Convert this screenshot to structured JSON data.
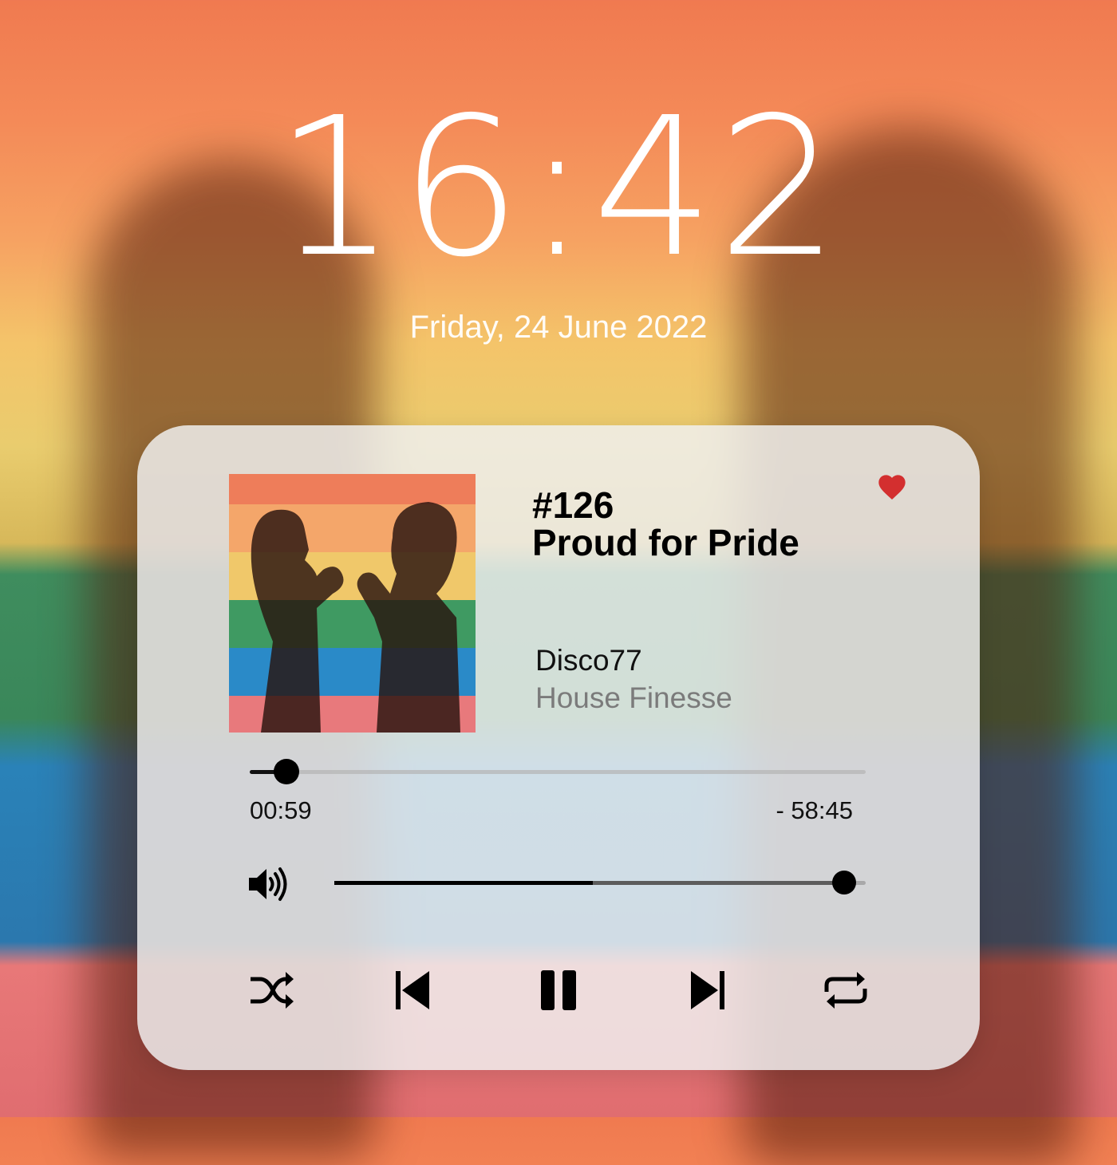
{
  "lockscreen": {
    "time": "16:42",
    "date": "Friday, 24 June 2022"
  },
  "player": {
    "episode": "#126",
    "title": "Proud for Pride",
    "artist": "Disco77",
    "genre": "House Finesse",
    "liked": true,
    "progress": {
      "elapsed": "00:59",
      "remaining": "- 58:45",
      "fraction": 0.06
    },
    "volume": {
      "level": 0.96
    },
    "controls": {
      "shuffle_icon": "shuffle-icon",
      "previous_icon": "skip-previous-icon",
      "pause_icon": "pause-icon",
      "next_icon": "skip-next-icon",
      "repeat_icon": "repeat-icon"
    }
  },
  "colors": {
    "heart": "#d32f2f",
    "card": "#f0f0f0",
    "text_primary": "#000000",
    "text_secondary": "#7b7b7b"
  }
}
